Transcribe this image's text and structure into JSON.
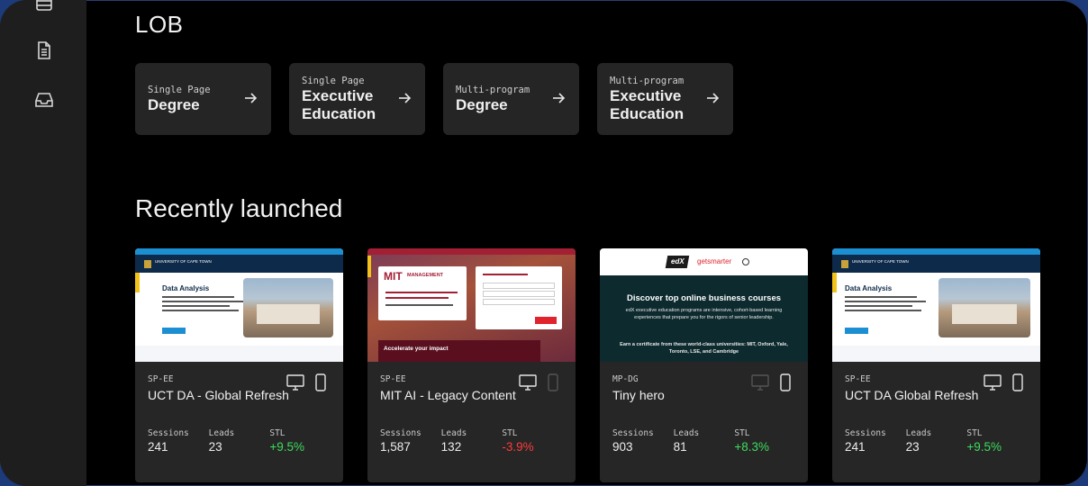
{
  "sidebar": {
    "icons": [
      "list-icon",
      "document-icon",
      "inbox-icon"
    ]
  },
  "lob": {
    "title": "LOB",
    "cards": [
      {
        "sub": "Single Page",
        "main": "Degree"
      },
      {
        "sub": "Single Page",
        "main": "Executive Education"
      },
      {
        "sub": "Multi-program",
        "main": "Degree"
      },
      {
        "sub": "Multi-program",
        "main": "Executive Education"
      }
    ]
  },
  "recent": {
    "title": "Recently launched",
    "stat_labels": {
      "sessions": "Sessions",
      "leads": "Leads",
      "stl": "STL"
    },
    "cards": [
      {
        "code": "SP-EE",
        "name": "UCT DA - Global Refresh",
        "sessions": "241",
        "leads": "23",
        "stl": "+9.5%",
        "stl_trend": "positive",
        "desktop_active": true,
        "mobile_active": true,
        "thumb": {
          "heading": "Data Analysis",
          "brand": "UNIVERSITY OF CAPE TOWN"
        }
      },
      {
        "code": "SP-EE",
        "name": "MIT AI - Legacy Content",
        "sessions": "1,587",
        "leads": "132",
        "stl": "-3.9%",
        "stl_trend": "negative",
        "desktop_active": true,
        "mobile_active": false,
        "thumb": {
          "logo": "MIT",
          "logo_text": "MANAGEMENT",
          "banner": "Accelerate your impact"
        }
      },
      {
        "code": "MP-DG",
        "name": "Tiny hero",
        "sessions": "903",
        "leads": "81",
        "stl": "+8.3%",
        "stl_trend": "positive",
        "desktop_active": false,
        "mobile_active": true,
        "thumb": {
          "logo1": "edX",
          "logo2": "getsmarter",
          "heading": "Discover top online business courses",
          "body": "edX executive education programs are intensive, cohort-based learning experiences that prepare you for the rigors of senior leadership.",
          "body2": "Earn a certificate from these world-class universities: MIT, Oxford, Yale, Toronto, LSE, and Cambridge"
        }
      },
      {
        "code": "SP-EE",
        "name": "UCT DA Global Refresh",
        "sessions": "241",
        "leads": "23",
        "stl": "+9.5%",
        "stl_trend": "positive",
        "desktop_active": true,
        "mobile_active": true,
        "thumb": {
          "heading": "Data Analysis",
          "brand": "UNIVERSITY OF CAPE TOWN"
        }
      }
    ]
  },
  "colors": {
    "background": "#000000",
    "sidebar": "#1e1e1e",
    "card": "#262626",
    "positive": "#3ddc5c",
    "negative": "#ff3b3b"
  }
}
